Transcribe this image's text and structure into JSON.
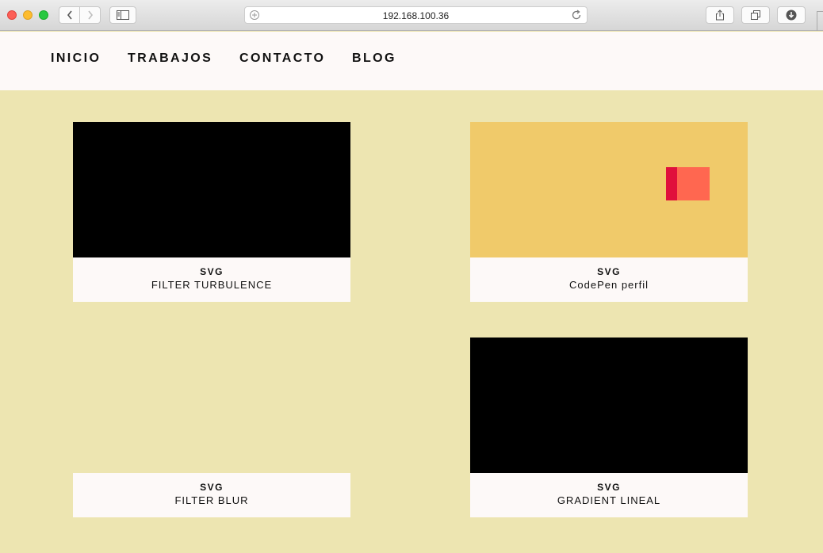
{
  "browser": {
    "url": "192.168.100.36"
  },
  "nav": {
    "items": [
      {
        "label": "INICIO"
      },
      {
        "label": "TRABAJOS"
      },
      {
        "label": "CONTACTO"
      },
      {
        "label": "BLOG"
      }
    ]
  },
  "colors": {
    "page_background": "#ede5b1",
    "caption_background": "#fdf9f8",
    "codepen_thumb_background": "#f0ca6a",
    "codepen_shape_main": "#ff6750",
    "codepen_shape_edge": "#e0103c"
  },
  "cards": [
    {
      "tag": "SVG",
      "title": "FILTER TURBULENCE"
    },
    {
      "tag": "SVG",
      "title": "CodePen perfil"
    },
    {
      "tag": "SVG",
      "title": "FILTER BLUR"
    },
    {
      "tag": "SVG",
      "title": "GRADIENT LINEAL"
    }
  ]
}
